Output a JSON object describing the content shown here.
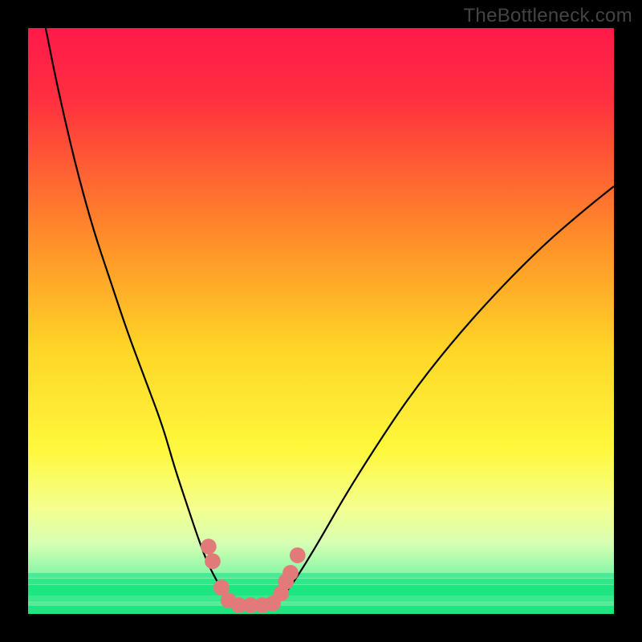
{
  "watermark": "TheBottleneck.com",
  "chart_data": {
    "type": "line",
    "title": "",
    "xlabel": "",
    "ylabel": "",
    "xlim": [
      0,
      100
    ],
    "ylim": [
      0,
      100
    ],
    "gradient_stops": [
      {
        "pct": 0,
        "color": "#ff1a4b"
      },
      {
        "pct": 12,
        "color": "#ff2f3f"
      },
      {
        "pct": 35,
        "color": "#ff8a2a"
      },
      {
        "pct": 55,
        "color": "#ffd626"
      },
      {
        "pct": 72,
        "color": "#fff83c"
      },
      {
        "pct": 82,
        "color": "#f4ff8f"
      },
      {
        "pct": 88,
        "color": "#d6ffb3"
      },
      {
        "pct": 93,
        "color": "#8cf7a8"
      },
      {
        "pct": 97,
        "color": "#34e98a"
      },
      {
        "pct": 100,
        "color": "#1de582"
      }
    ],
    "green_bands": [
      {
        "top_pct": 93.0,
        "height_pct": 0.9,
        "color": "#48eb95"
      },
      {
        "top_pct": 94.0,
        "height_pct": 0.9,
        "color": "#2fe88c"
      },
      {
        "top_pct": 95.0,
        "height_pct": 1.8,
        "color": "#1de582"
      },
      {
        "top_pct": 96.8,
        "height_pct": 0.9,
        "color": "#38e98d"
      },
      {
        "top_pct": 97.8,
        "height_pct": 0.8,
        "color": "#5aeb9a"
      },
      {
        "top_pct": 98.6,
        "height_pct": 1.4,
        "color": "#1de582"
      }
    ],
    "series": [
      {
        "name": "left-curve",
        "x": [
          3,
          5,
          8,
          11,
          14,
          17,
          20,
          23,
          25,
          27,
          29,
          30.5,
          32,
          33.2,
          34.2,
          35
        ],
        "y": [
          100,
          90,
          77,
          66,
          57,
          48,
          40,
          32,
          25,
          19,
          13,
          9,
          6,
          4,
          2.5,
          1.5
        ]
      },
      {
        "name": "right-curve",
        "x": [
          42,
          43.5,
          45,
          47,
          50,
          54,
          59,
          65,
          72,
          80,
          88,
          95,
          100
        ],
        "y": [
          1.5,
          3,
          5,
          8,
          13,
          20,
          28,
          37,
          46,
          55,
          63,
          69,
          73
        ]
      },
      {
        "name": "floor-segment",
        "x": [
          35,
          42
        ],
        "y": [
          1.5,
          1.5
        ]
      }
    ],
    "markers": {
      "name": "highlighted-points",
      "color": "#e27a7a",
      "points": [
        {
          "x": 30.8,
          "y": 11.5
        },
        {
          "x": 31.5,
          "y": 9.0
        },
        {
          "x": 33.0,
          "y": 4.5
        },
        {
          "x": 34.2,
          "y": 2.3
        },
        {
          "x": 36.0,
          "y": 1.5
        },
        {
          "x": 38.0,
          "y": 1.5
        },
        {
          "x": 40.0,
          "y": 1.5
        },
        {
          "x": 41.8,
          "y": 1.8
        },
        {
          "x": 43.2,
          "y": 3.5
        },
        {
          "x": 44.0,
          "y": 5.5
        },
        {
          "x": 44.8,
          "y": 7.0
        },
        {
          "x": 46.0,
          "y": 10.0
        }
      ]
    }
  }
}
